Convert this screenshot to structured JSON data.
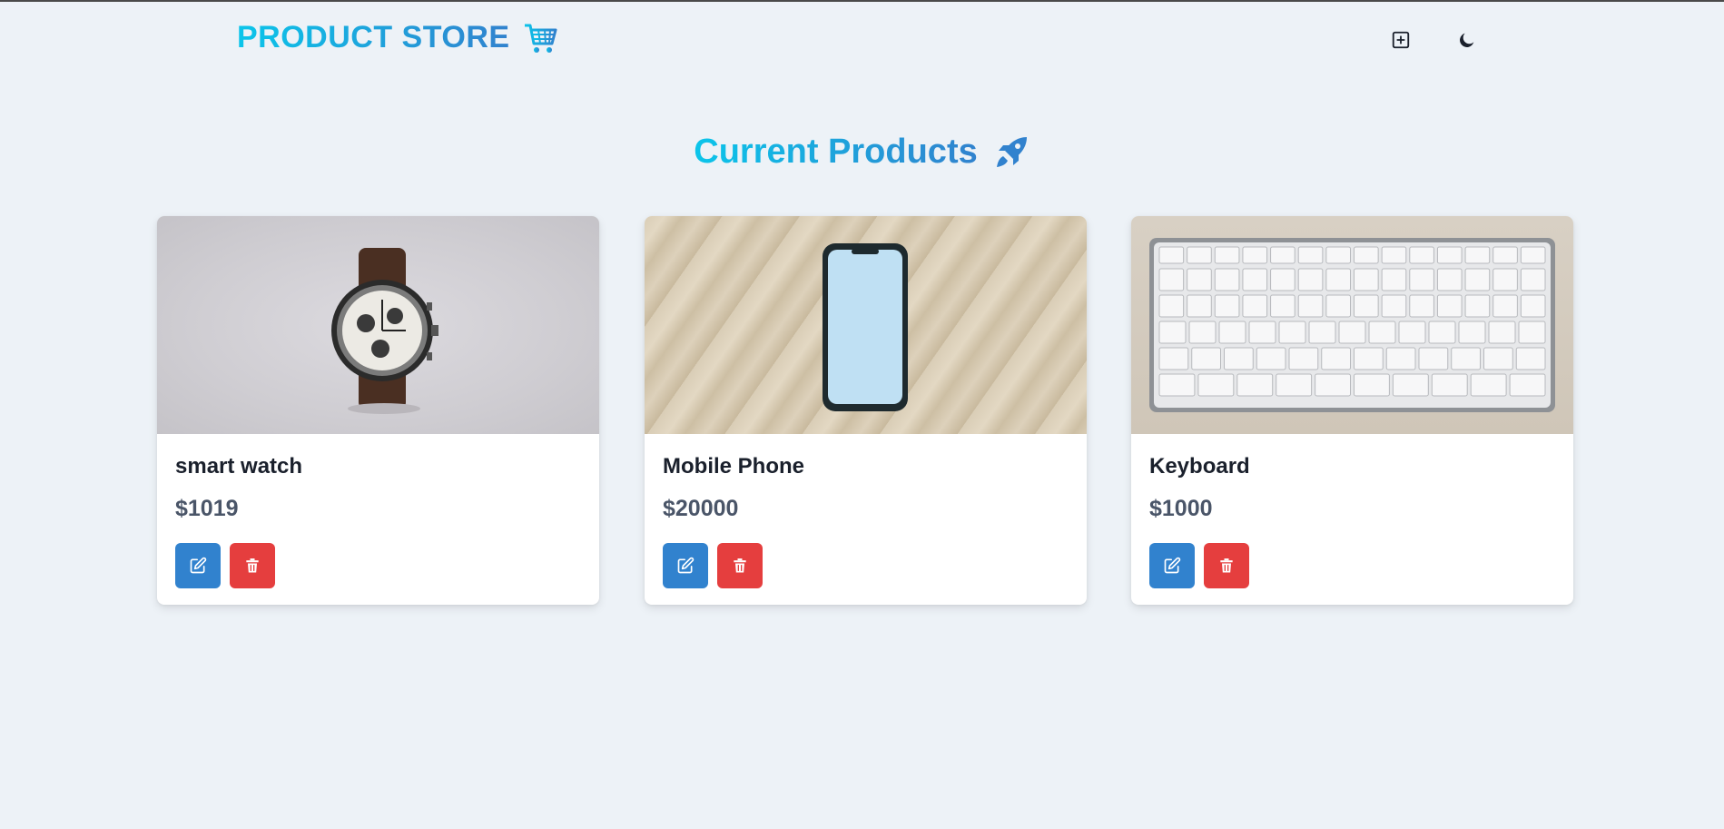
{
  "navbar": {
    "brand_title": "PRODUCT STORE",
    "brand_icon": "shopping-cart-icon",
    "create_icon": "plus-square-icon",
    "theme_icon": "moon-icon"
  },
  "main": {
    "heading": "Current Products",
    "heading_icon": "rocket-icon"
  },
  "products": [
    {
      "name": "smart watch",
      "price": "$1019",
      "image": "wristwatch-photo"
    },
    {
      "name": "Mobile Phone",
      "price": "$20000",
      "image": "smartphone-photo"
    },
    {
      "name": "Keyboard",
      "price": "$1000",
      "image": "keyboard-photo"
    }
  ],
  "colors": {
    "background": "#edf2f7",
    "gradient_start": "#0bc5ea",
    "gradient_end": "#3182ce",
    "edit_button": "#3182ce",
    "delete_button": "#e53e3e"
  }
}
